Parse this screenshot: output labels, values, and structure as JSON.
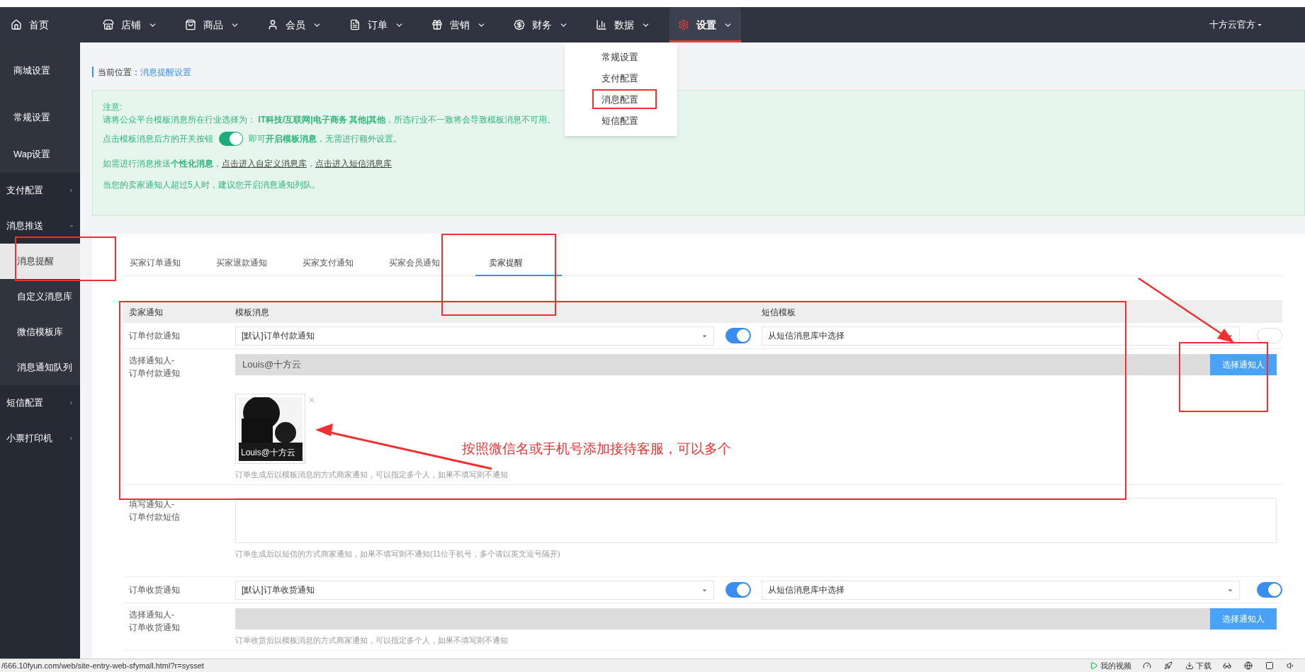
{
  "top_nav": {
    "home": "首页",
    "items": [
      {
        "label": "店铺",
        "selected": false
      },
      {
        "label": "商品",
        "selected": false
      },
      {
        "label": "会员",
        "selected": false
      },
      {
        "label": "订单",
        "selected": false
      },
      {
        "label": "营销",
        "selected": false
      },
      {
        "label": "财务",
        "selected": false
      },
      {
        "label": "数据",
        "selected": false
      },
      {
        "label": "设置",
        "selected": true
      }
    ],
    "user": "十方云官方"
  },
  "settings_menu": {
    "items": [
      {
        "label": "常规设置"
      },
      {
        "label": "支付配置"
      },
      {
        "label": "消息配置"
      },
      {
        "label": "短信配置"
      }
    ]
  },
  "sidebar": {
    "items": [
      {
        "kind": "link",
        "label": "商城设置"
      },
      {
        "kind": "link",
        "label": "常规设置"
      },
      {
        "kind": "link",
        "label": "Wap设置"
      },
      {
        "kind": "group",
        "label": "支付配置",
        "expanded": false
      },
      {
        "kind": "group",
        "label": "消息推送",
        "expanded": true,
        "children": [
          {
            "label": "消息提醒",
            "selected": true
          },
          {
            "label": "自定义消息库",
            "selected": false
          },
          {
            "label": "微信模板库",
            "selected": false
          },
          {
            "label": "消息通知队列",
            "selected": false
          }
        ]
      },
      {
        "kind": "group",
        "label": "短信配置",
        "expanded": false
      },
      {
        "kind": "group",
        "label": "小票打印机",
        "expanded": false
      }
    ]
  },
  "breadcrumb": {
    "label": "当前位置：",
    "current": "消息提醒设置"
  },
  "notice": {
    "title": "注意:",
    "industry": "请将公众平台模板消息所在行业选择为： **IT科技/互联网|电子商务 其他|其他**，所选行业不一致将会导致模板消息不可用。",
    "switch_before": "点击模板消息后方的开关按钮",
    "switch_on": true,
    "switch_after": "即可**开启模板消息**，无需进行额外设置。",
    "custom_before": "如需进行消息推送**个性化消息**，",
    "custom_link": "点击进入自定义消息库",
    "custom_sep": "，",
    "sms_link": "点击进入短信消息库",
    "queue": "当您的卖家通知人超过5人时，建议您开启消息通知列队。"
  },
  "tabs": [
    {
      "label": "买家订单通知",
      "selected": false
    },
    {
      "label": "买家退款通知",
      "selected": false
    },
    {
      "label": "买家支付通知",
      "selected": false
    },
    {
      "label": "买家会员通知",
      "selected": false
    },
    {
      "label": "卖家提醒",
      "selected": true
    }
  ],
  "table": {
    "columns": [
      "卖家通知",
      "模板消息",
      "短信模板"
    ],
    "rows": [
      {
        "kind": "template",
        "label": "订单付款通知",
        "template": "[默认]订单付款通知",
        "template_on": true,
        "sms": "从短信消息库中选择",
        "sms_on": false
      },
      {
        "kind": "recipients",
        "label": "选择通知人-\n订单付款通知",
        "value": "Louis@十方云",
        "button": "选择通知人",
        "recipients": [
          {
            "name": "Louis@十方云"
          }
        ],
        "hint": "订单生成后以模板消息的方式商家通知，可以指定多个人，如果不填写则不通知"
      },
      {
        "kind": "phones",
        "label": "填写通知人-\n订单付款短信",
        "hint": "订单生成后以短信的方式商家通知，如果不填写则不通知(11位手机号，多个请以英文逗号隔开)"
      },
      {
        "kind": "template",
        "label": "订单收货通知",
        "template": "[默认]订单收货通知",
        "template_on": true,
        "sms": "从短信消息库中选择",
        "sms_on": true
      },
      {
        "kind": "recipients",
        "label": "选择通知人-\n订单收货通知",
        "button": "选择通知人",
        "hint": "订单收货后以模板消息的方式商家通知，可以指定多个人，如果不填写则不通知"
      }
    ]
  },
  "annotation": {
    "text": "按照微信名或手机号添加接待客服，可以多个"
  },
  "status_bar": {
    "url": "/666.10fyun.com/web/site-entry-web-sfymall.html?r=sysset",
    "video": "我的视频",
    "download": "下载"
  }
}
